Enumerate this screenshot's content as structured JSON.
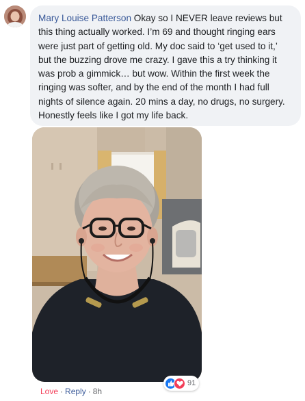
{
  "comment": {
    "author": "Mary Louise Patterson",
    "text": "Okay so I NEVER leave reviews but this thing actually worked. I’m 69 and thought ringing ears were just part of getting old. My doc said to ‘get used to it,’ but the buzzing drove me crazy. I gave this a try thinking it was prob a gimmick… but wow. Within the first week the ringing was softer, and by the end of the month I had full nights of silence again. 20 mins a day, no drugs, no surgery. Honestly feels like I got my life back."
  },
  "reactions": {
    "icons": [
      "like-icon",
      "love-icon"
    ],
    "count": "91"
  },
  "actions": {
    "love_label": "Love",
    "reply_label": "Reply",
    "separator": "·",
    "time": "8h"
  },
  "colors": {
    "bubble": "#f0f2f5",
    "author": "#385898",
    "love": "#f33e58",
    "like": "#1877f2",
    "meta": "#65676b"
  }
}
